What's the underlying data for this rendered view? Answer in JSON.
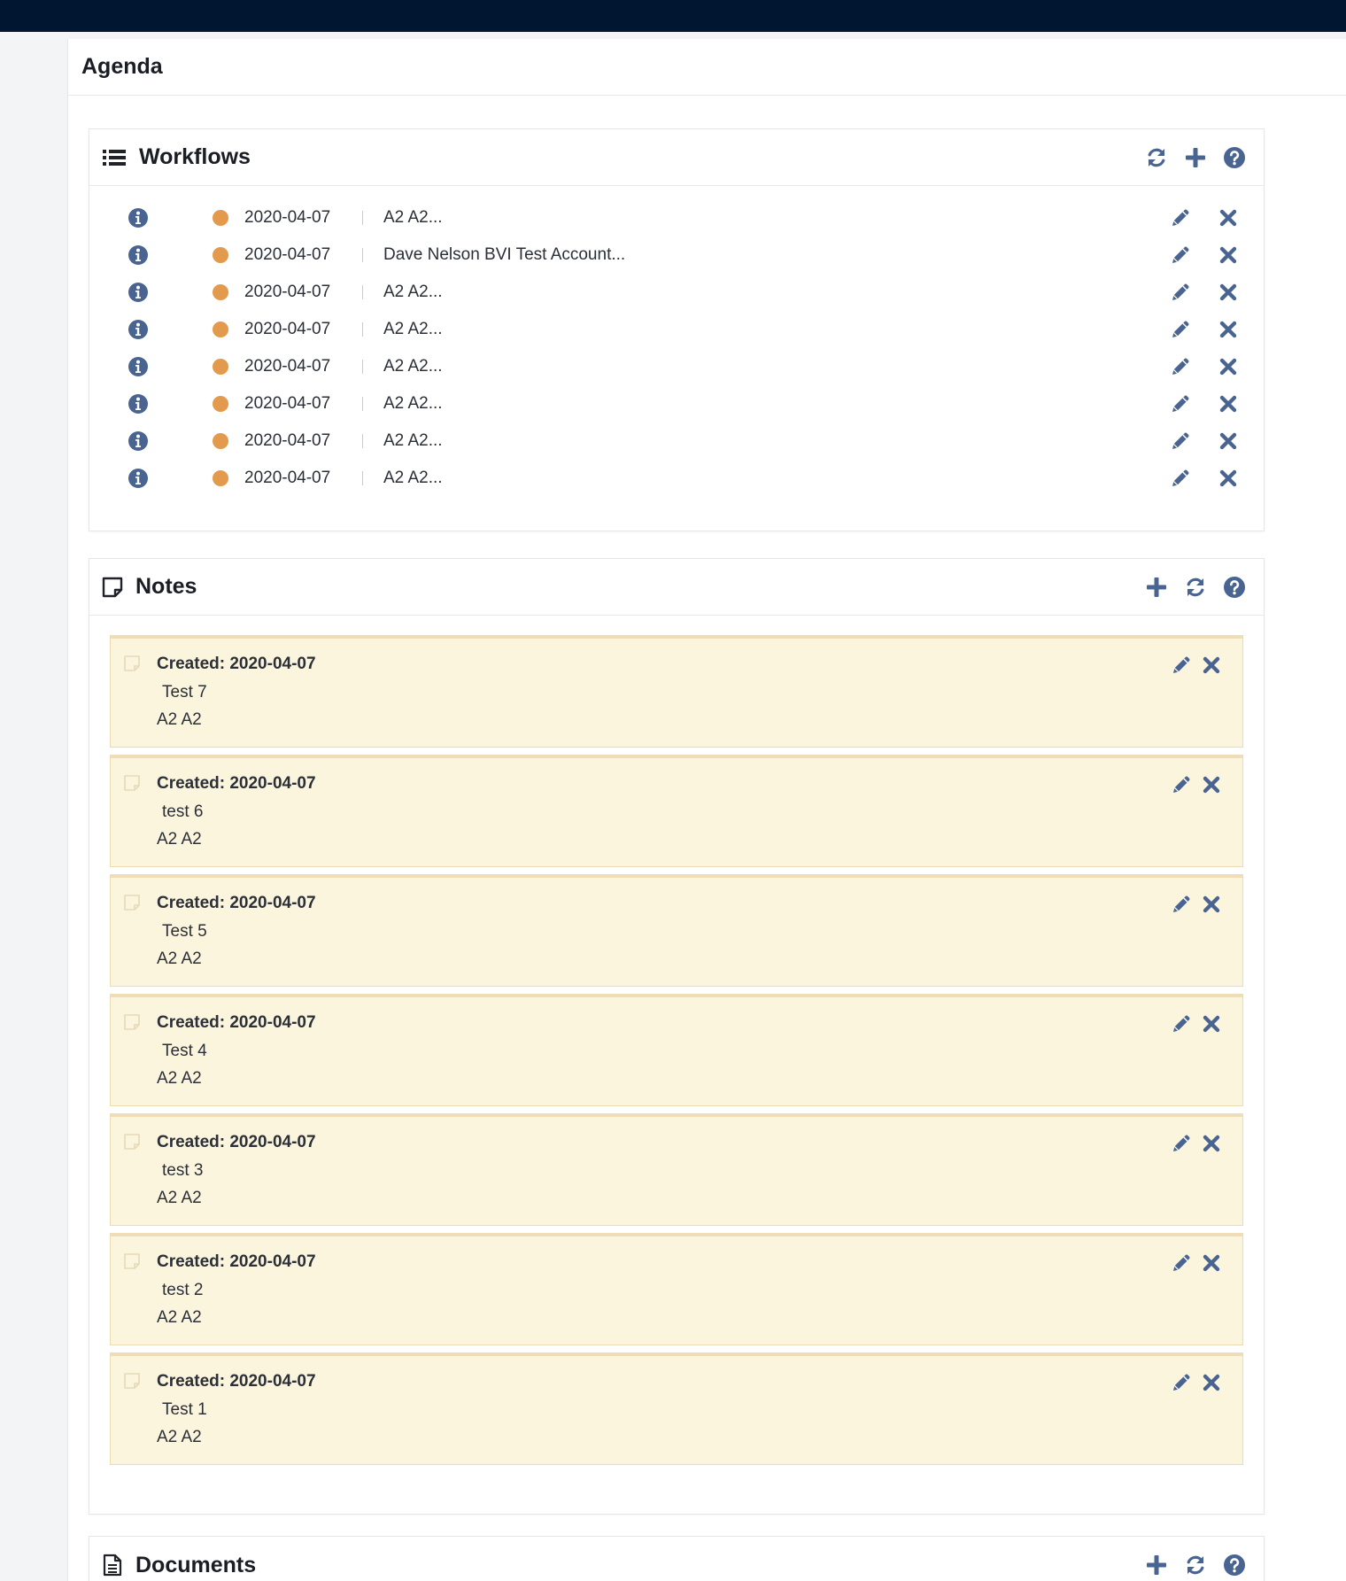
{
  "page": {
    "title": "Agenda"
  },
  "colors": {
    "topbar": "#001631",
    "icon": "#4a6491",
    "status_dot": "#e39a4c",
    "note_bg": "#fcf5de"
  },
  "workflows": {
    "title": "Workflows",
    "actions": [
      "refresh-icon",
      "plus-icon",
      "help-icon"
    ],
    "items": [
      {
        "date": "2020-04-07",
        "title": "A2 A2...",
        "status": "in-progress"
      },
      {
        "date": "2020-04-07",
        "title": "Dave Nelson BVI Test Account...",
        "status": "in-progress"
      },
      {
        "date": "2020-04-07",
        "title": "A2 A2...",
        "status": "in-progress"
      },
      {
        "date": "2020-04-07",
        "title": "A2 A2...",
        "status": "in-progress"
      },
      {
        "date": "2020-04-07",
        "title": "A2 A2...",
        "status": "in-progress"
      },
      {
        "date": "2020-04-07",
        "title": "A2 A2...",
        "status": "in-progress"
      },
      {
        "date": "2020-04-07",
        "title": "A2 A2...",
        "status": "in-progress"
      },
      {
        "date": "2020-04-07",
        "title": "A2 A2...",
        "status": "in-progress"
      }
    ]
  },
  "notes": {
    "title": "Notes",
    "actions": [
      "plus-icon",
      "refresh-icon",
      "help-icon"
    ],
    "items": [
      {
        "created": "Created: 2020-04-07",
        "title": "Test 7",
        "author": "A2 A2"
      },
      {
        "created": "Created: 2020-04-07",
        "title": "test 6",
        "author": "A2 A2"
      },
      {
        "created": "Created: 2020-04-07",
        "title": "Test 5",
        "author": "A2 A2"
      },
      {
        "created": "Created: 2020-04-07",
        "title": "Test 4",
        "author": "A2 A2"
      },
      {
        "created": "Created: 2020-04-07",
        "title": "test 3",
        "author": "A2 A2"
      },
      {
        "created": "Created: 2020-04-07",
        "title": "test 2",
        "author": "A2 A2"
      },
      {
        "created": "Created: 2020-04-07",
        "title": "Test 1",
        "author": "A2 A2"
      }
    ]
  },
  "documents": {
    "title": "Documents",
    "actions": [
      "plus-icon",
      "refresh-icon",
      "help-icon"
    ]
  }
}
